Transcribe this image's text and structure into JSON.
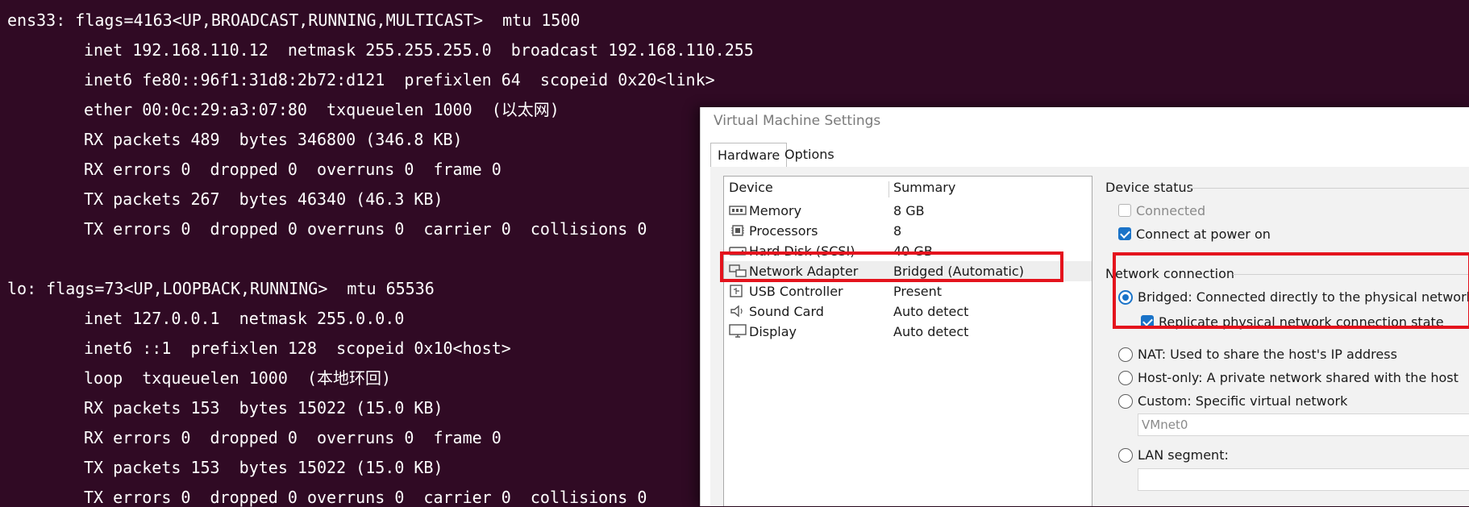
{
  "terminal": {
    "lines": [
      "ens33: flags=4163<UP,BROADCAST,RUNNING,MULTICAST>  mtu 1500",
      "inet 192.168.110.12  netmask 255.255.255.0  broadcast 192.168.110.255",
      "inet6 fe80::96f1:31d8:2b72:d121  prefixlen 64  scopeid 0x20<link>",
      "ether 00:0c:29:a3:07:80  txqueuelen 1000  (以太网)",
      "RX packets 489  bytes 346800 (346.8 KB)",
      "RX errors 0  dropped 0  overruns 0  frame 0",
      "TX packets 267  bytes 46340 (46.3 KB)",
      "TX errors 0  dropped 0 overruns 0  carrier 0  collisions 0",
      "",
      "lo: flags=73<UP,LOOPBACK,RUNNING>  mtu 65536",
      "inet 127.0.0.1  netmask 255.0.0.0",
      "inet6 ::1  prefixlen 128  scopeid 0x10<host>",
      "loop  txqueuelen 1000  (本地环回)",
      "RX packets 153  bytes 15022 (15.0 KB)",
      "RX errors 0  dropped 0  overruns 0  frame 0",
      "TX packets 153  bytes 15022 (15.0 KB)",
      "TX errors 0  dropped 0 overruns 0  carrier 0  collisions 0"
    ],
    "background": "#300a24"
  },
  "dialog": {
    "title": "Virtual Machine Settings",
    "tabs": {
      "hardware": "Hardware",
      "options": "Options"
    },
    "device_list": {
      "header_device": "Device",
      "header_summary": "Summary",
      "items": [
        {
          "name": "Memory",
          "summary": "8 GB",
          "icon": "memory-icon"
        },
        {
          "name": "Processors",
          "summary": "8",
          "icon": "processor-icon"
        },
        {
          "name": "Hard Disk (SCSI)",
          "summary": "40 GB",
          "icon": "hard-disk-icon"
        },
        {
          "name": "Network Adapter",
          "summary": "Bridged (Automatic)",
          "icon": "network-adapter-icon",
          "selected": true
        },
        {
          "name": "USB Controller",
          "summary": "Present",
          "icon": "usb-icon"
        },
        {
          "name": "Sound Card",
          "summary": "Auto detect",
          "icon": "speaker-icon"
        },
        {
          "name": "Display",
          "summary": "Auto detect",
          "icon": "monitor-icon"
        }
      ]
    },
    "device_status": {
      "title": "Device status",
      "connected": "Connected",
      "connect_at_power_on": "Connect at power on"
    },
    "network_connection": {
      "title": "Network connection",
      "bridged": "Bridged: Connected directly to the physical network",
      "replicate": "Replicate physical network connection state",
      "nat": "NAT: Used to share the host's IP address",
      "host_only": "Host-only: A private network shared with the host",
      "custom": "Custom: Specific virtual network",
      "custom_value": "VMnet0",
      "lan_segment": "LAN segment:"
    },
    "colors": {
      "accent": "#1a73c8",
      "highlight": "#e4131d"
    }
  }
}
